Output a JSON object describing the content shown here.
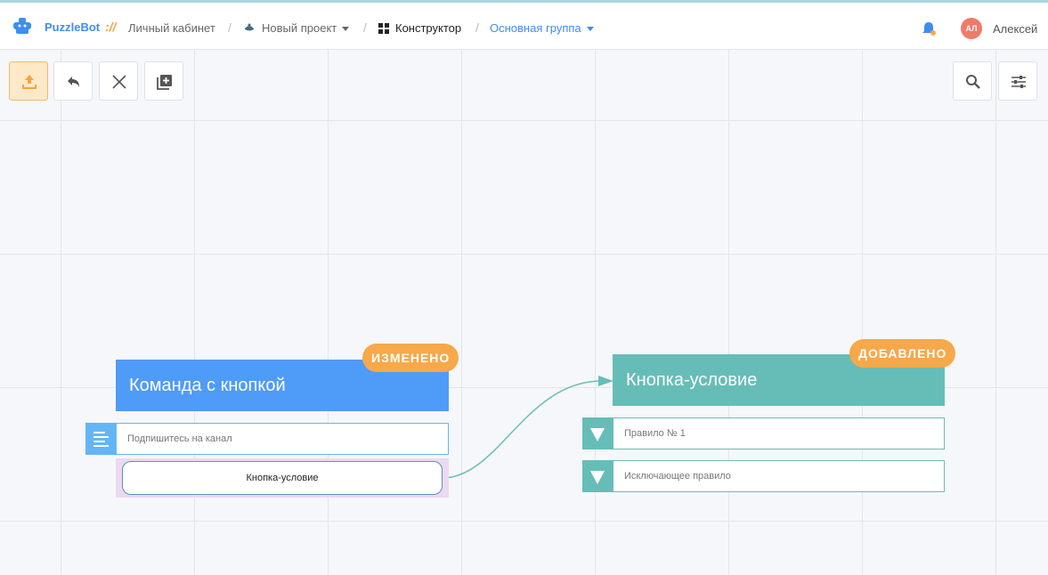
{
  "header": {
    "brand": "PuzzleBot",
    "brand_sep": "://",
    "crumbs": {
      "cabinet": "Личный кабинет",
      "project": "Новый проект",
      "constructor": "Конструктор",
      "group": "Основная группа"
    },
    "user": {
      "initials": "АЛ",
      "name": "Алексей"
    }
  },
  "toolbar": {
    "left": [
      "upload-icon",
      "undo-icon",
      "close-icon",
      "add-block-icon"
    ],
    "right": [
      "search-icon",
      "settings-sliders-icon"
    ]
  },
  "nodes": {
    "command": {
      "title": "Команда с кнопкой",
      "badge": "ИЗМЕНЕНО",
      "color": "#4f9bf8",
      "rows": [
        {
          "text": "Подпишитесь на канал",
          "icon": "text-lines-icon"
        }
      ],
      "button": "Кнопка-условие"
    },
    "condition": {
      "title": "Кнопка-условие",
      "badge": "ДОБАВЛЕНО",
      "color": "#66bdb8",
      "rules": [
        {
          "text": "Правило № 1",
          "icon": "triangle-down-icon"
        },
        {
          "text": "Исключающее правило",
          "icon": "triangle-down-icon"
        }
      ]
    }
  },
  "colors": {
    "accent": "#3d8ef0",
    "badge": "#f7a849",
    "teal": "#66bdb8",
    "blue": "#4f9bf8"
  }
}
